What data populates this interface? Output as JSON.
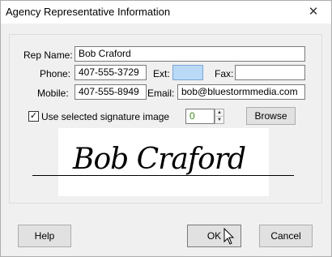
{
  "window": {
    "title": "Agency Representative Information",
    "close_glyph": "✕"
  },
  "labels": {
    "rep_name": "Rep Name:",
    "phone": "Phone:",
    "ext": "Ext:",
    "fax": "Fax:",
    "mobile": "Mobile:",
    "email": "Email:"
  },
  "fields": {
    "rep_name": "Bob Craford",
    "phone": "407-555-3729",
    "ext": "",
    "fax": "",
    "mobile": "407-555-8949",
    "email": "bob@bluestormmedia.com"
  },
  "signature": {
    "checkbox_label": "Use selected signature image",
    "checked": true,
    "check_glyph": "✓",
    "index_value": "0",
    "spin_up_glyph": "▲",
    "spin_down_glyph": "▼",
    "browse_label": "Browse",
    "image_text": "Bob Craford"
  },
  "buttons": {
    "help": "Help",
    "ok": "OK",
    "cancel": "Cancel"
  },
  "icons": {
    "close": "close-icon",
    "cursor": "mouse-pointer-icon"
  }
}
